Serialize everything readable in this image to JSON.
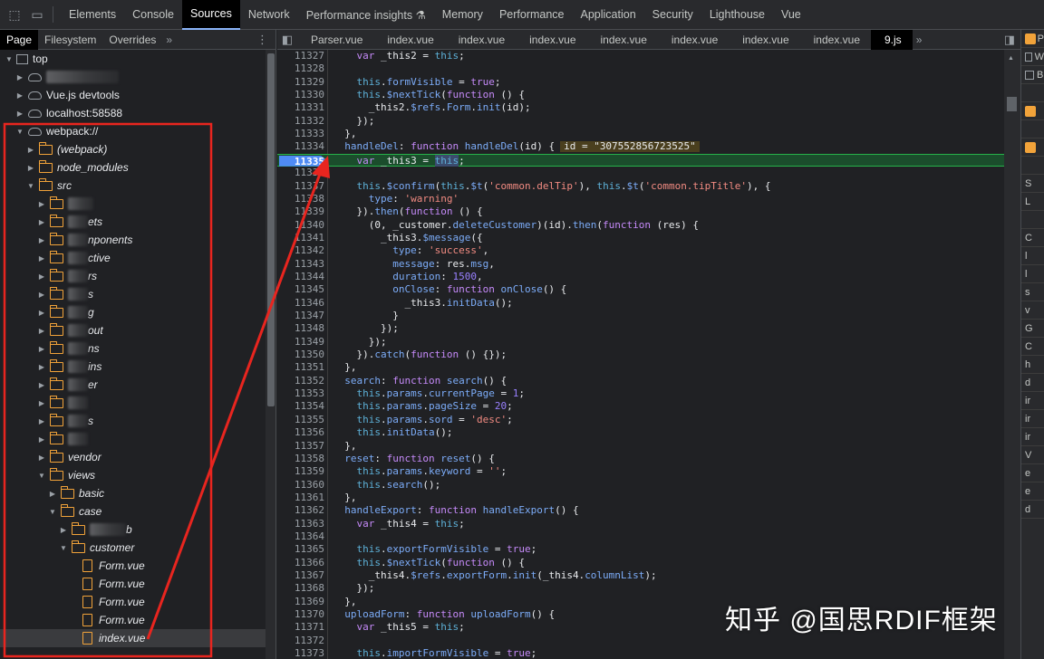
{
  "devtools": {
    "panel_tabs": [
      "Elements",
      "Console",
      "Sources",
      "Network",
      "Performance insights",
      "Memory",
      "Performance",
      "Application",
      "Security",
      "Lighthouse",
      "Vue"
    ],
    "active_tab": "Sources"
  },
  "navigator": {
    "tabs": [
      "Page",
      "Filesystem",
      "Overrides"
    ],
    "active_tab": "Page",
    "tree": [
      {
        "depth": 0,
        "arrow": "down",
        "icon": "frame",
        "label": "top"
      },
      {
        "depth": 1,
        "arrow": "right",
        "icon": "cloud",
        "label": "",
        "blur": 80
      },
      {
        "depth": 1,
        "arrow": "right",
        "icon": "cloud",
        "label": "Vue.js devtools"
      },
      {
        "depth": 1,
        "arrow": "right",
        "icon": "cloud",
        "label": "localhost:58588"
      },
      {
        "depth": 1,
        "arrow": "down",
        "icon": "cloud",
        "label": "webpack://"
      },
      {
        "depth": 2,
        "arrow": "right",
        "icon": "folder",
        "label": "(webpack)",
        "italic": true
      },
      {
        "depth": 2,
        "arrow": "right",
        "icon": "folder",
        "label": "node_modules",
        "italic": true
      },
      {
        "depth": 2,
        "arrow": "down",
        "icon": "folder",
        "label": "src",
        "italic": true
      },
      {
        "depth": 3,
        "arrow": "right",
        "icon": "folder",
        "label": "",
        "blur": 28
      },
      {
        "depth": 3,
        "arrow": "right",
        "icon": "folder",
        "label": "ets",
        "blur": 22,
        "italic": true
      },
      {
        "depth": 3,
        "arrow": "right",
        "icon": "folder",
        "label": "nponents",
        "blur": 22,
        "italic": true
      },
      {
        "depth": 3,
        "arrow": "right",
        "icon": "folder",
        "label": "ctive",
        "blur": 22,
        "italic": true
      },
      {
        "depth": 3,
        "arrow": "right",
        "icon": "folder",
        "label": "rs",
        "blur": 22,
        "italic": true
      },
      {
        "depth": 3,
        "arrow": "right",
        "icon": "folder",
        "label": "s",
        "blur": 22,
        "italic": true
      },
      {
        "depth": 3,
        "arrow": "right",
        "icon": "folder",
        "label": "g",
        "blur": 22,
        "italic": true
      },
      {
        "depth": 3,
        "arrow": "right",
        "icon": "folder",
        "label": "out",
        "blur": 22,
        "italic": true
      },
      {
        "depth": 3,
        "arrow": "right",
        "icon": "folder",
        "label": "ns",
        "blur": 22,
        "italic": true
      },
      {
        "depth": 3,
        "arrow": "right",
        "icon": "folder",
        "label": "ins",
        "blur": 22,
        "italic": true
      },
      {
        "depth": 3,
        "arrow": "right",
        "icon": "folder",
        "label": "er",
        "blur": 22,
        "italic": true
      },
      {
        "depth": 3,
        "arrow": "right",
        "icon": "folder",
        "label": "",
        "blur": 22
      },
      {
        "depth": 3,
        "arrow": "right",
        "icon": "folder",
        "label": "s",
        "blur": 22,
        "italic": true
      },
      {
        "depth": 3,
        "arrow": "right",
        "icon": "folder",
        "label": "",
        "blur": 22
      },
      {
        "depth": 3,
        "arrow": "right",
        "icon": "folder",
        "label": "vendor",
        "italic": true
      },
      {
        "depth": 3,
        "arrow": "down",
        "icon": "folder",
        "label": "views",
        "italic": true
      },
      {
        "depth": 4,
        "arrow": "right",
        "icon": "folder",
        "label": "basic",
        "italic": true
      },
      {
        "depth": 4,
        "arrow": "down",
        "icon": "folder",
        "label": "case",
        "italic": true
      },
      {
        "depth": 5,
        "arrow": "right",
        "icon": "folder",
        "label": "b",
        "blur": 40,
        "italic": true
      },
      {
        "depth": 5,
        "arrow": "down",
        "icon": "folder",
        "label": "customer",
        "italic": true
      },
      {
        "depth": 6,
        "arrow": "",
        "icon": "file",
        "label": "Form.vue",
        "italic": true
      },
      {
        "depth": 6,
        "arrow": "",
        "icon": "file",
        "label": "Form.vue",
        "italic": true
      },
      {
        "depth": 6,
        "arrow": "",
        "icon": "file",
        "label": "Form.vue",
        "italic": true
      },
      {
        "depth": 6,
        "arrow": "",
        "icon": "file",
        "label": "Form.vue",
        "italic": true
      },
      {
        "depth": 6,
        "arrow": "",
        "icon": "file",
        "label": "index.vue",
        "italic": true,
        "selected": true
      }
    ]
  },
  "editor": {
    "tabs": [
      "Parser.vue",
      "index.vue",
      "index.vue",
      "index.vue",
      "index.vue",
      "index.vue",
      "index.vue",
      "index.vue",
      "9.js"
    ],
    "active_tab": "9.js",
    "paused_line": 11335,
    "inline_value": "id = \"307552856723525\"",
    "lines": [
      {
        "n": "11327",
        "html": "    <span class=kw>var</span> _this2 = <span class=k2>this</span>;"
      },
      {
        "n": "11328",
        "html": ""
      },
      {
        "n": "11329",
        "html": "    <span class=k2>this</span>.<span class=fn>formVisible</span> = <span class=kw>true</span>;"
      },
      {
        "n": "11330",
        "html": "    <span class=k2>this</span>.<span class=fn>$nextTick</span>(<span class=kw>function</span> () {"
      },
      {
        "n": "11331",
        "html": "      _this2.<span class=fn>$refs</span>.<span class=fn>Form</span>.<span class=fn>init</span>(id);"
      },
      {
        "n": "11332",
        "html": "    });"
      },
      {
        "n": "11333",
        "html": "  },"
      },
      {
        "n": "11334",
        "html": "  <span class=fn>handleDel</span>: <span class=kw>function</span> <span class=fn>handleDel</span>(id) {"
      },
      {
        "n": "11335",
        "html": "    <span class=kw>var</span> _this3 = <span class=cursor><span class=k2>this</span></span>;"
      },
      {
        "n": "11336",
        "html": ""
      },
      {
        "n": "11337",
        "html": "    <span class=k2>this</span>.<span class=fn>$confirm</span>(<span class=k2>this</span>.<span class=fn>$t</span>(<span class=st>'common.delTip'</span>), <span class=k2>this</span>.<span class=fn>$t</span>(<span class=st>'common.tipTitle'</span>), {"
      },
      {
        "n": "11338",
        "html": "      <span class=fn>type</span>: <span class=st>'warning'</span>"
      },
      {
        "n": "11339",
        "html": "    }).<span class=fn>then</span>(<span class=kw>function</span> () {"
      },
      {
        "n": "11340",
        "html": "      (0, _customer.<span class=fn>deleteCustomer</span>)(id).<span class=fn>then</span>(<span class=kw>function</span> (res) {"
      },
      {
        "n": "11341",
        "html": "        _this3.<span class=fn>$message</span>({"
      },
      {
        "n": "11342",
        "html": "          <span class=fn>type</span>: <span class=st>'success'</span>,"
      },
      {
        "n": "11343",
        "html": "          <span class=fn>message</span>: res.<span class=fn>msg</span>,"
      },
      {
        "n": "11344",
        "html": "          <span class=fn>duration</span>: <span class=nm>1500</span>,"
      },
      {
        "n": "11345",
        "html": "          <span class=fn>onClose</span>: <span class=kw>function</span> <span class=fn>onClose</span>() {"
      },
      {
        "n": "11346",
        "html": "            _this3.<span class=fn>initData</span>();"
      },
      {
        "n": "11347",
        "html": "          }"
      },
      {
        "n": "11348",
        "html": "        });"
      },
      {
        "n": "11349",
        "html": "      });"
      },
      {
        "n": "11350",
        "html": "    }).<span class=fn>catch</span>(<span class=kw>function</span> () {});"
      },
      {
        "n": "11351",
        "html": "  },"
      },
      {
        "n": "11352",
        "html": "  <span class=fn>search</span>: <span class=kw>function</span> <span class=fn>search</span>() {"
      },
      {
        "n": "11353",
        "html": "    <span class=k2>this</span>.<span class=fn>params</span>.<span class=fn>currentPage</span> = <span class=nm>1</span>;"
      },
      {
        "n": "11354",
        "html": "    <span class=k2>this</span>.<span class=fn>params</span>.<span class=fn>pageSize</span> = <span class=nm>20</span>;"
      },
      {
        "n": "11355",
        "html": "    <span class=k2>this</span>.<span class=fn>params</span>.<span class=fn>sord</span> = <span class=st>'desc'</span>;"
      },
      {
        "n": "11356",
        "html": "    <span class=k2>this</span>.<span class=fn>initData</span>();"
      },
      {
        "n": "11357",
        "html": "  },"
      },
      {
        "n": "11358",
        "html": "  <span class=fn>reset</span>: <span class=kw>function</span> <span class=fn>reset</span>() {"
      },
      {
        "n": "11359",
        "html": "    <span class=k2>this</span>.<span class=fn>params</span>.<span class=fn>keyword</span> = <span class=st>''</span>;"
      },
      {
        "n": "11360",
        "html": "    <span class=k2>this</span>.<span class=fn>search</span>();"
      },
      {
        "n": "11361",
        "html": "  },"
      },
      {
        "n": "11362",
        "html": "  <span class=fn>handleExport</span>: <span class=kw>function</span> <span class=fn>handleExport</span>() {"
      },
      {
        "n": "11363",
        "html": "    <span class=kw>var</span> _this4 = <span class=k2>this</span>;"
      },
      {
        "n": "11364",
        "html": ""
      },
      {
        "n": "11365",
        "html": "    <span class=k2>this</span>.<span class=fn>exportFormVisible</span> = <span class=kw>true</span>;"
      },
      {
        "n": "11366",
        "html": "    <span class=k2>this</span>.<span class=fn>$nextTick</span>(<span class=kw>function</span> () {"
      },
      {
        "n": "11367",
        "html": "      _this4.<span class=fn>$refs</span>.<span class=fn>exportForm</span>.<span class=fn>init</span>(_this4.<span class=fn>columnList</span>);"
      },
      {
        "n": "11368",
        "html": "    });"
      },
      {
        "n": "11369",
        "html": "  },"
      },
      {
        "n": "11370",
        "html": "  <span class=fn>uploadForm</span>: <span class=kw>function</span> <span class=fn>uploadForm</span>() {"
      },
      {
        "n": "11371",
        "html": "    <span class=kw>var</span> _this5 = <span class=k2>this</span>;"
      },
      {
        "n": "11372",
        "html": ""
      },
      {
        "n": "11373",
        "html": "    <span class=k2>this</span>.<span class=fn>importFormVisible</span> = <span class=kw>true</span>;"
      }
    ]
  },
  "right_panel": {
    "rows": [
      "P",
      "W",
      "B",
      "",
      "",
      "",
      "",
      "",
      "S",
      "L",
      "",
      "C",
      "l",
      "l",
      "s",
      "v",
      "G",
      "C",
      "h",
      "d",
      "ir",
      "ir",
      "ir",
      "V",
      "e",
      "e",
      "d"
    ]
  },
  "watermark": "知乎 @国思RDIF框架",
  "colors": {
    "annotation": "#e8251f",
    "breakpoint": "#4f8bf5",
    "paused_line": "#1b4d2c"
  }
}
